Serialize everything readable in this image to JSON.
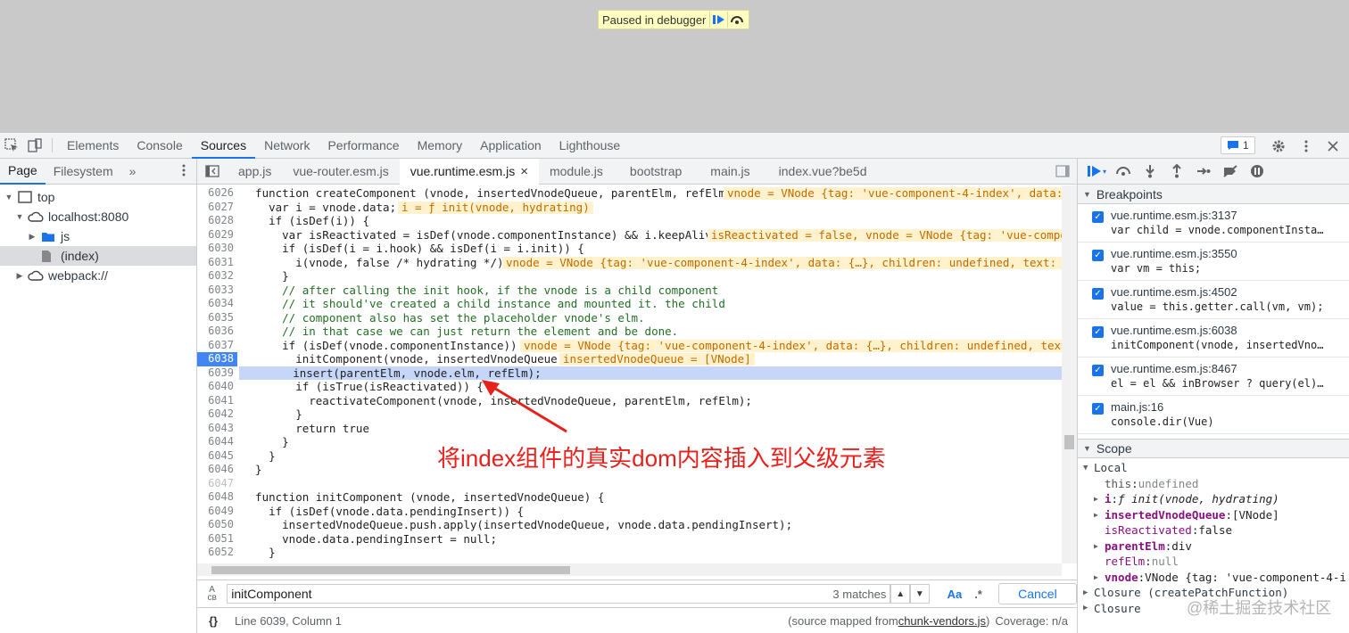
{
  "paused_overlay": {
    "label": "Paused in debugger",
    "icons": [
      "resume-icon",
      "step-over-icon"
    ]
  },
  "devtools": {
    "tabs": [
      "Elements",
      "Console",
      "Sources",
      "Network",
      "Performance",
      "Memory",
      "Application",
      "Lighthouse"
    ],
    "active_tab": "Sources",
    "issues_count": "1"
  },
  "navigator": {
    "tabs": [
      "Page",
      "Filesystem"
    ],
    "more": "»",
    "tree": {
      "top": "top",
      "host": "localhost:8080",
      "folder_js": "js",
      "index": "(index)",
      "webpack": "webpack://"
    }
  },
  "editor": {
    "file_tabs": [
      "app.js",
      "vue-router.esm.js",
      "vue.runtime.esm.js",
      "module.js",
      "bootstrap",
      "main.js",
      "index.vue?be5d"
    ],
    "active_file": "vue.runtime.esm.js",
    "close_glyph": "×",
    "lines": [
      {
        "n": "6026",
        "code": "  function createComponent (vnode, insertedVnodeQueue, parentElm, refElm) {",
        "inline": "vnode = VNode {tag: 'vue-component-4-index', data: {"
      },
      {
        "n": "6027",
        "code": "    var i = vnode.data;",
        "inline": "i = ƒ init(vnode, hydrating)"
      },
      {
        "n": "6028",
        "code": "    if (isDef(i)) {",
        "inline": ""
      },
      {
        "n": "6029",
        "code": "      var isReactivated = isDef(vnode.componentInstance) && i.keepAlive;",
        "inline": "isReactivated = false, vnode = VNode {tag: 'vue-compone"
      },
      {
        "n": "6030",
        "code": "      if (isDef(i = i.hook) && isDef(i = i.init)) {",
        "inline": ""
      },
      {
        "n": "6031",
        "code": "        i(vnode, false /* hydrating */);",
        "inline": "vnode = VNode {tag: 'vue-component-4-index', data: {…}, children: undefined, text: unde"
      },
      {
        "n": "6032",
        "code": "      }",
        "inline": ""
      },
      {
        "n": "6033",
        "code": "      // after calling the init hook, if the vnode is a child component",
        "inline": ""
      },
      {
        "n": "6034",
        "code": "      // it should've created a child instance and mounted it. the child",
        "inline": ""
      },
      {
        "n": "6035",
        "code": "      // component also has set the placeholder vnode's elm.",
        "inline": ""
      },
      {
        "n": "6036",
        "code": "      // in that case we can just return the element and be done.",
        "inline": ""
      },
      {
        "n": "6037",
        "code": "      if (isDef(vnode.componentInstance)) {",
        "inline": "vnode = VNode {tag: 'vue-component-4-index', data: {…}, children: undefined, text: u"
      },
      {
        "n": "6038",
        "code": "        initComponent(vnode, insertedVnodeQueue);",
        "inline": "insertedVnodeQueue = [VNode]"
      },
      {
        "n": "6039",
        "code": "        insert(parentElm, vnode.elm, refElm);",
        "inline": ""
      },
      {
        "n": "6040",
        "code": "        if (isTrue(isReactivated)) {",
        "inline": ""
      },
      {
        "n": "6041",
        "code": "          reactivateComponent(vnode, insertedVnodeQueue, parentElm, refElm);",
        "inline": ""
      },
      {
        "n": "6042",
        "code": "        }",
        "inline": ""
      },
      {
        "n": "6043",
        "code": "        return true",
        "inline": ""
      },
      {
        "n": "6044",
        "code": "      }",
        "inline": ""
      },
      {
        "n": "6045",
        "code": "    }",
        "inline": ""
      },
      {
        "n": "6046",
        "code": "  }",
        "inline": ""
      },
      {
        "n": "6047",
        "code": "",
        "inline": ""
      },
      {
        "n": "6048",
        "code": "  function initComponent (vnode, insertedVnodeQueue) {",
        "inline": ""
      },
      {
        "n": "6049",
        "code": "    if (isDef(vnode.data.pendingInsert)) {",
        "inline": ""
      },
      {
        "n": "6050",
        "code": "      insertedVnodeQueue.push.apply(insertedVnodeQueue, vnode.data.pendingInsert);",
        "inline": ""
      },
      {
        "n": "6051",
        "code": "      vnode.data.pendingInsert = null;",
        "inline": ""
      },
      {
        "n": "6052",
        "code": "    }",
        "inline": ""
      }
    ],
    "breakpoint_line": "6038",
    "current_line": "6039"
  },
  "search": {
    "value": "initComponent",
    "matches": "3 matches",
    "case_label": "Aa",
    "regex_label": ".*",
    "cancel": "Cancel"
  },
  "status": {
    "position": "Line 6039, Column 1",
    "source_prefix": "(source mapped from ",
    "source_file": "chunk-vendors.js",
    "source_suffix": ")",
    "coverage": "Coverage: n/a",
    "braces": "{}"
  },
  "sidebar": {
    "breakpoints_title": "Breakpoints",
    "breakpoints": [
      {
        "file": "vue.runtime.esm.js:3137",
        "code": "var child = vnode.componentInsta…"
      },
      {
        "file": "vue.runtime.esm.js:3550",
        "code": "var vm = this;"
      },
      {
        "file": "vue.runtime.esm.js:4502",
        "code": "value = this.getter.call(vm, vm);"
      },
      {
        "file": "vue.runtime.esm.js:6038",
        "code": "initComponent(vnode, insertedVno…"
      },
      {
        "file": "vue.runtime.esm.js:8467",
        "code": "el = el && inBrowser ? query(el)…"
      },
      {
        "file": "main.js:16",
        "code": "console.dir(Vue)"
      }
    ],
    "scope_title": "Scope",
    "local_title": "Local",
    "scope": [
      {
        "key": "this",
        "sep": ": ",
        "val": "undefined",
        "arrow": ""
      },
      {
        "key": "i",
        "sep": ": ",
        "val": "ƒ init(vnode, hydrating)",
        "arrow": "▶"
      },
      {
        "key": "insertedVnodeQueue",
        "sep": ": ",
        "val": "[VNode]",
        "arrow": "▶"
      },
      {
        "key": "isReactivated",
        "sep": ": ",
        "val": "false",
        "arrow": ""
      },
      {
        "key": "parentElm",
        "sep": ": ",
        "val": "div",
        "arrow": "▶"
      },
      {
        "key": "refElm",
        "sep": ": ",
        "val": "null",
        "arrow": ""
      },
      {
        "key": "vnode",
        "sep": ": ",
        "val": "VNode {tag: 'vue-component-4-i",
        "arrow": "▶"
      }
    ],
    "closure1": "Closure (createPatchFunction)",
    "closure2": "Closure"
  },
  "annotation": "将index组件的真实dom内容插入到父级元素",
  "watermark": "@稀土掘金技术社区",
  "colors": {
    "accent": "#1a73e8",
    "breakpoint": "#4285f4",
    "annotation": "#e8201b"
  }
}
